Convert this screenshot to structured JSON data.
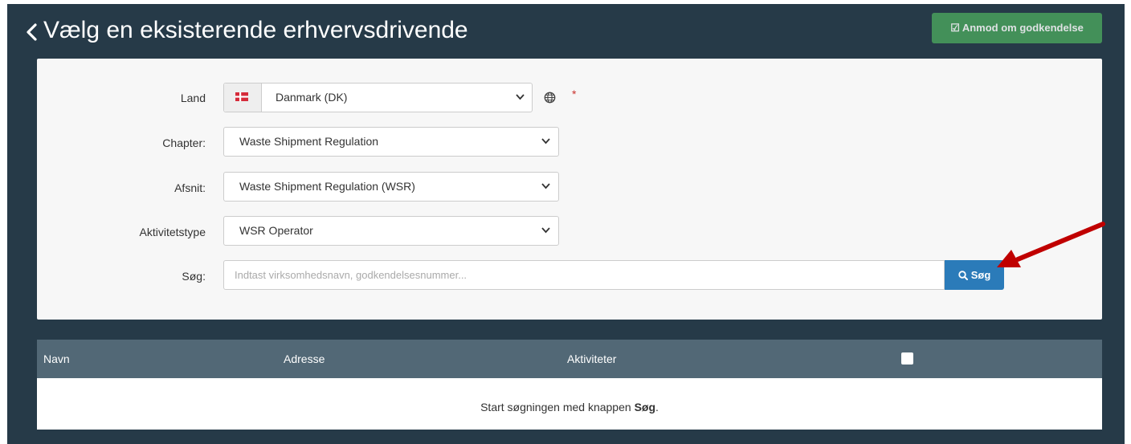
{
  "header": {
    "title": "Vælg en eksisterende erhvervsdrivende",
    "approve_button": "Anmod om godkendelse"
  },
  "form": {
    "country": {
      "label": "Land",
      "value": "Danmark (DK)",
      "required_mark": "*"
    },
    "chapter": {
      "label": "Chapter:",
      "value": "Waste Shipment Regulation"
    },
    "section": {
      "label": "Afsnit:",
      "value": "Waste Shipment Regulation (WSR)"
    },
    "activity_type": {
      "label": "Aktivitetstype",
      "value": "WSR Operator"
    },
    "search": {
      "label": "Søg:",
      "placeholder": "Indtast virksomhedsnavn, godkendelsesnummer...",
      "value": "",
      "button": "Søg"
    }
  },
  "table": {
    "columns": [
      "Navn",
      "Adresse",
      "Aktiviteter"
    ],
    "empty_message_prefix": "Start søgningen med knappen ",
    "empty_message_bold": "Søg",
    "empty_message_suffix": "."
  },
  "colors": {
    "background": "#263a48",
    "approve_button": "#49a05c",
    "search_button": "#2b7bb9",
    "table_header": "#526876",
    "annotation_arrow": "#c00000"
  },
  "icons": [
    "chevron-left-icon",
    "checkbox-icon",
    "flag-dk-icon",
    "chevron-down-icon",
    "globe-icon",
    "search-icon",
    "arrow-annotation"
  ]
}
